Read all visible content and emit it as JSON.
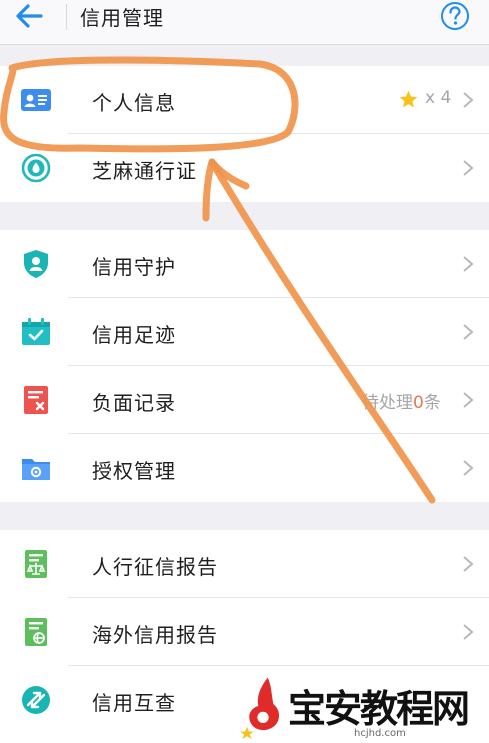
{
  "header": {
    "title": "信用管理"
  },
  "group1": [
    {
      "name": "personal-info",
      "label": "个人信息",
      "icon": "id-card-icon",
      "rating": "x 4"
    },
    {
      "name": "sesame-pass",
      "label": "芝麻通行证",
      "icon": "sesame-pass-icon"
    }
  ],
  "group2": [
    {
      "name": "credit-guard",
      "label": "信用守护",
      "icon": "shield-user-icon"
    },
    {
      "name": "credit-footprint",
      "label": "信用足迹",
      "icon": "calendar-check-icon"
    },
    {
      "name": "negative-record",
      "label": "负面记录",
      "icon": "negative-record-icon",
      "status_prefix": "待处理",
      "status_count": "0",
      "status_suffix": "条"
    },
    {
      "name": "authorization-manage",
      "label": "授权管理",
      "icon": "folder-gear-icon"
    }
  ],
  "group3": [
    {
      "name": "pboc-credit-report",
      "label": "人行征信报告",
      "icon": "report-scale-icon"
    },
    {
      "name": "overseas-credit-report",
      "label": "海外信用报告",
      "icon": "report-globe-icon"
    },
    {
      "name": "credit-mutual-check",
      "label": "信用互查",
      "icon": "mutual-check-icon"
    }
  ],
  "watermark": {
    "text": "宝安教程网",
    "url": "hcjhd.com"
  },
  "colors": {
    "accent_blue": "#1e8cf0",
    "teal": "#20b8b8",
    "red": "#ef5350",
    "green": "#4caf50",
    "annotation_orange": "#f0944a",
    "star_gold": "#f6c21c"
  }
}
